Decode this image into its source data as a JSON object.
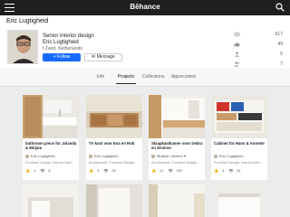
{
  "topbar": {
    "logo": "Bēhance"
  },
  "profile": {
    "name": "Eric Lugtigheid",
    "role": "Senior interior design",
    "username": "Eric Lugtigheid",
    "location": "t Zand, Netherlands",
    "follow_label": "Follow",
    "message_label": "Message",
    "stats": [
      {
        "icon": "eye-icon",
        "value": "617"
      },
      {
        "icon": "thumb-up-icon",
        "value": "49"
      },
      {
        "icon": "person-icon",
        "value": "5"
      },
      {
        "icon": "person-plus-icon",
        "value": "7"
      }
    ]
  },
  "tabs": [
    "Info",
    "Projects",
    "Collections",
    "Appreciated"
  ],
  "active_tab": "Projects",
  "projects": [
    {
      "title": "bathroom piece for Jolanda & Mirjam",
      "owner": "Eric Lugtigheid",
      "fields": "Furniture Design, Interior Desi...",
      "likes": "1",
      "views": "8"
    },
    {
      "title": "TV kast voor Eva en Rob",
      "owner": "Eric Lugtigheid",
      "fields": "Architecture, Furniture Design...",
      "likes": "0",
      "views": "32"
    },
    {
      "title": "Slaapkastkamer voor Debra en Desiree",
      "owner": "Multiple Owners",
      "fields": "Architecture, Furniture Design...",
      "likes": "12",
      "views": "287"
    },
    {
      "title": "Cabinet for Hans & Annette",
      "owner": "Eric Lugtigheid",
      "fields": "Furniture Design, Interior Desi...",
      "likes": "4",
      "views": "81"
    }
  ]
}
